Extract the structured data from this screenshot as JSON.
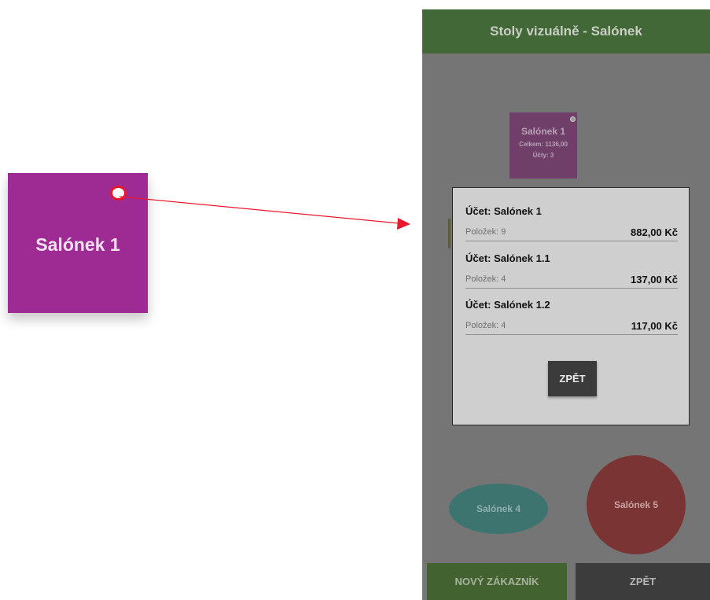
{
  "callout": {
    "table_label": "Salónek 1",
    "highlight_color": "#e8182c",
    "icon": "status-dot-icon"
  },
  "app": {
    "title": "Stoly vizuálně - Salónek",
    "accent": "#436837"
  },
  "table_card": {
    "name": "Salónek 1",
    "total": "Celkem: 1136,00",
    "accounts": "Účty: 3"
  },
  "dialog": {
    "accounts": [
      {
        "title": "Účet: Salónek 1",
        "items": "Položek: 9",
        "amount": "882,00 Kč"
      },
      {
        "title": "Účet: Salónek 1.1",
        "items": "Položek: 4",
        "amount": "137,00 Kč"
      },
      {
        "title": "Účet: Salónek 1.2",
        "items": "Položek: 4",
        "amount": "117,00 Kč"
      }
    ],
    "back_label": "ZPĚT"
  },
  "tables": {
    "oval_label": "Salónek 4",
    "circle_label": "Salónek 5"
  },
  "footer": {
    "new_customer_label": "NOVÝ ZÁKAZNÍK",
    "back_label": "ZPĚT"
  }
}
